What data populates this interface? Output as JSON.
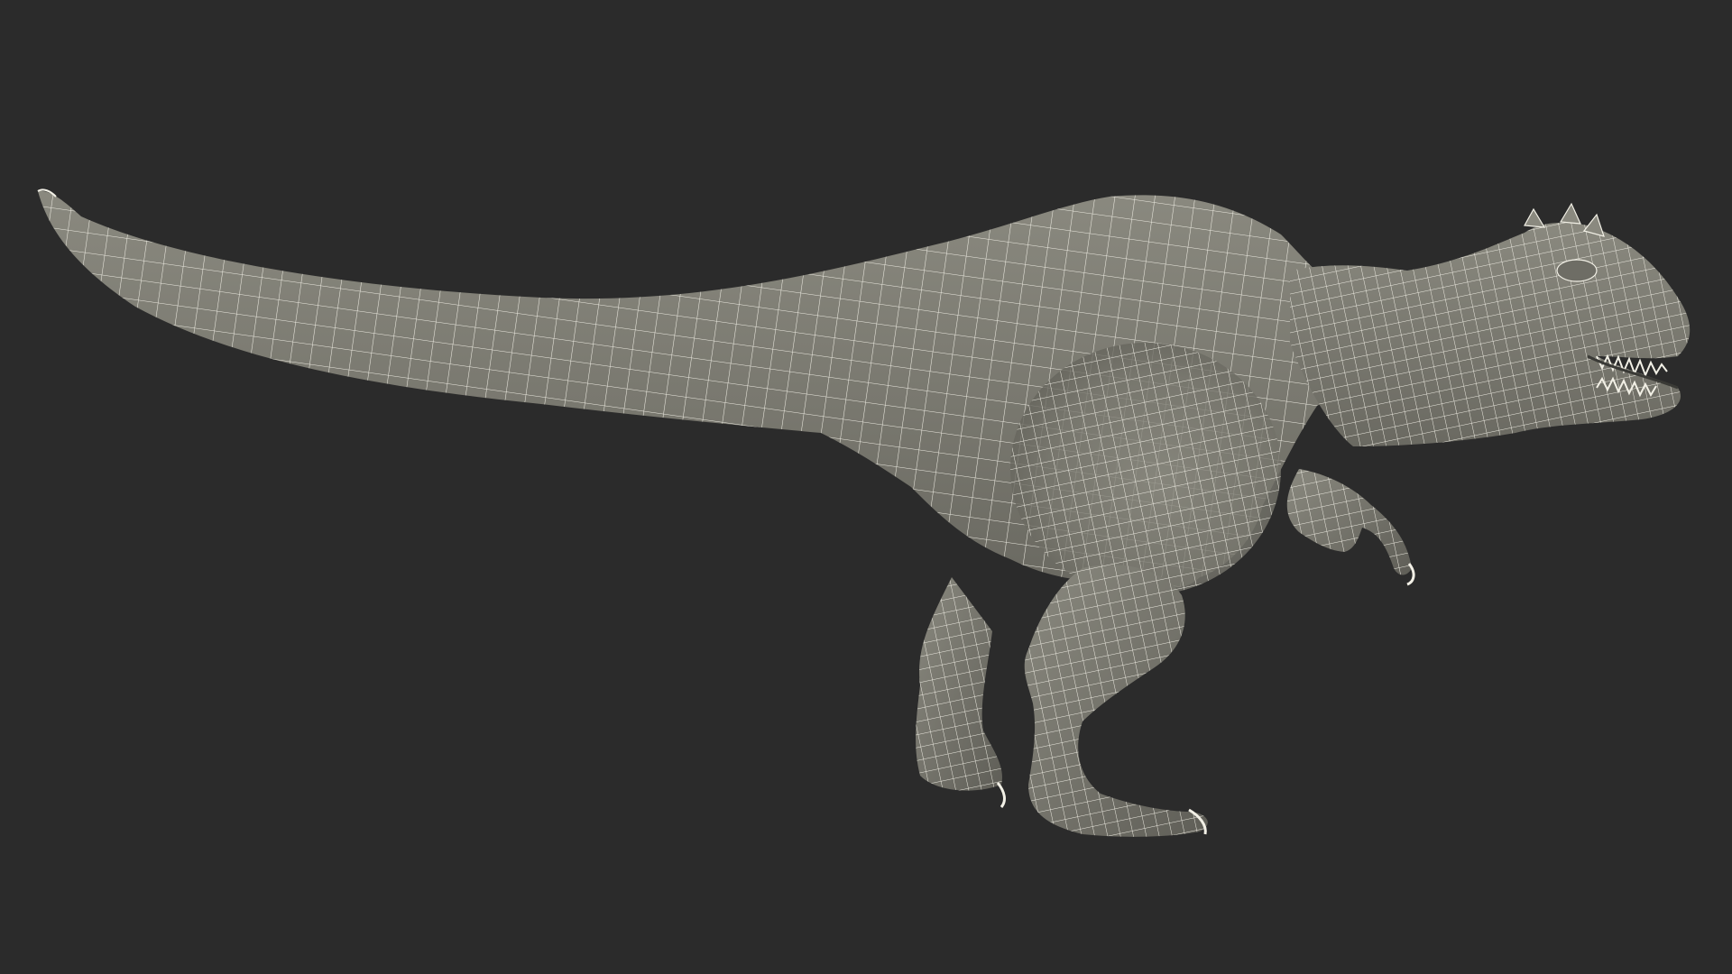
{
  "scene": {
    "subject_icon": "dinosaur-wireframe-icon",
    "colors": {
      "background": "#2b2b2b",
      "mesh_fill": "#7d7c72",
      "mesh_fill_light": "#a7a69b",
      "mesh_fill_dark": "#5d5c55",
      "wire": "#f2f0e6",
      "shadow": "#4c4b46"
    }
  }
}
